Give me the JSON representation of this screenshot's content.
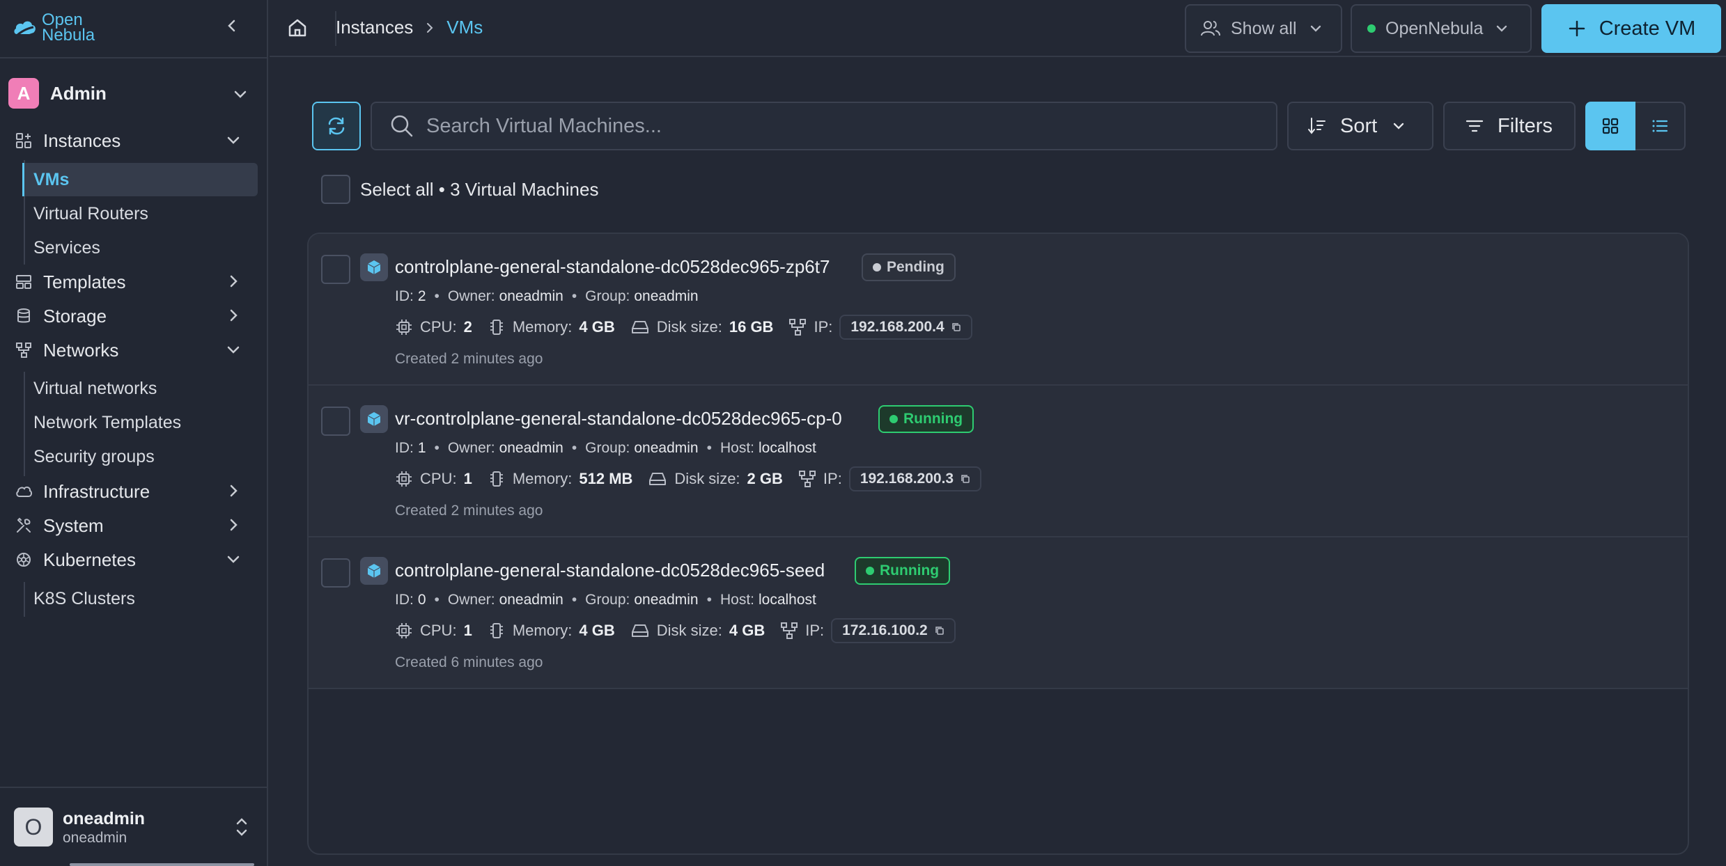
{
  "app": {
    "logo_text": [
      "Open",
      "Nebula"
    ]
  },
  "sidebar": {
    "group": {
      "avatar": "A",
      "label": "Admin"
    },
    "sections": [
      {
        "label": "Instances",
        "icon": "instances-icon",
        "expanded": true,
        "items": [
          "VMs",
          "Virtual Routers",
          "Services"
        ]
      },
      {
        "label": "Templates",
        "icon": "templates-icon",
        "expanded": false
      },
      {
        "label": "Storage",
        "icon": "storage-icon",
        "expanded": false
      },
      {
        "label": "Networks",
        "icon": "networks-icon",
        "expanded": true,
        "items": [
          "Virtual networks",
          "Network Templates",
          "Security groups"
        ]
      },
      {
        "label": "Infrastructure",
        "icon": "cloud-icon",
        "expanded": false
      },
      {
        "label": "System",
        "icon": "tools-icon",
        "expanded": false
      },
      {
        "label": "Kubernetes",
        "icon": "kubernetes-icon",
        "expanded": true,
        "items": [
          "K8S Clusters"
        ]
      }
    ],
    "active_item": "VMs",
    "user": {
      "avatar": "O",
      "name": "oneadmin",
      "sub": "oneadmin"
    }
  },
  "topbar": {
    "breadcrumb": [
      "Instances",
      "VMs"
    ],
    "show_all": "Show all",
    "zone": "OpenNebula",
    "create": "Create VM"
  },
  "toolbar": {
    "search_placeholder": "Search Virtual Machines...",
    "sort": "Sort",
    "filters": "Filters"
  },
  "select_all": {
    "label": "Select all",
    "count_text": "3 Virtual Machines"
  },
  "vms": [
    {
      "name": "controlplane-general-standalone-dc0528dec965-zp6t7",
      "status": "Pending",
      "id": "2",
      "owner": "oneadmin",
      "group": "oneadmin",
      "host": null,
      "cpu": "2",
      "memory": "4 GB",
      "disk": "16 GB",
      "ip": "192.168.200.4",
      "created": "Created 2 minutes ago"
    },
    {
      "name": "vr-controlplane-general-standalone-dc0528dec965-cp-0",
      "status": "Running",
      "id": "1",
      "owner": "oneadmin",
      "group": "oneadmin",
      "host": "localhost",
      "cpu": "1",
      "memory": "512 MB",
      "disk": "2 GB",
      "ip": "192.168.200.3",
      "created": "Created 2 minutes ago"
    },
    {
      "name": "controlplane-general-standalone-dc0528dec965-seed",
      "status": "Running",
      "id": "0",
      "owner": "oneadmin",
      "group": "oneadmin",
      "host": "localhost",
      "cpu": "1",
      "memory": "4 GB",
      "disk": "4 GB",
      "ip": "172.16.100.2",
      "created": "Created 6 minutes ago"
    }
  ],
  "labels": {
    "id": "ID:",
    "owner": "Owner:",
    "group": "Group:",
    "host": "Host:",
    "cpu": "CPU:",
    "memory": "Memory:",
    "disk": "Disk size:",
    "ip": "IP:"
  },
  "colors": {
    "accent": "#5bc5f0",
    "running": "#2ecc71",
    "pending": "#c9ccd3",
    "admin_avatar": "#f07eb7"
  }
}
